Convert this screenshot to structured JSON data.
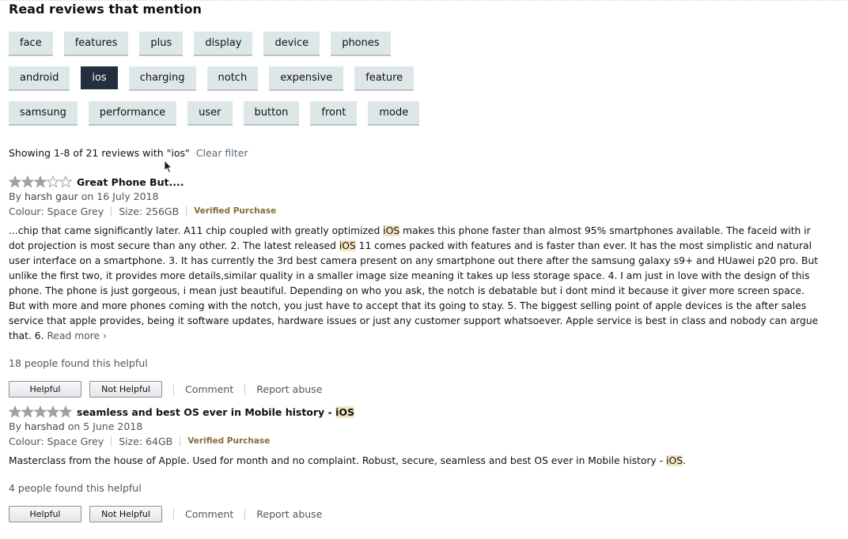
{
  "heading": "Read reviews that mention",
  "chips": {
    "row1": [
      "face",
      "features",
      "plus",
      "display",
      "device",
      "phones"
    ],
    "row2": [
      "android",
      "ios",
      "charging",
      "notch",
      "expensive",
      "feature"
    ],
    "row3": [
      "samsung",
      "performance",
      "user",
      "button",
      "front",
      "mode"
    ],
    "selected": "ios"
  },
  "filter": {
    "showing": "Showing 1-8 of 21 reviews with \"ios\"",
    "clear": "Clear filter"
  },
  "reviews": [
    {
      "rating": 3,
      "title": "Great Phone But....",
      "by": "By",
      "author": "harsh gaur",
      "date": "on 16 July 2018",
      "colour": "Colour: Space Grey",
      "size": "Size: 256GB",
      "verified": "Verified Purchase",
      "body_lines": [
        "...chip that came significantly later. A11 chip coupled with greatly optimized ",
        "iOS",
        " makes this phone faster than almost 95% smartphones available. The faceid with ir dot projection is most secure than any other. 2. The latest released ",
        "iOS",
        " 11 comes packed with features and is faster than ever. It has the most simplistic and natural user interface on a smartphone. 3. It has currently the 3rd best camera present on any smartphone out there after the samsung galaxy s9+ and HUawei p20 pro. But unlike the first two, it provides more details,similar quality in a smaller image size meaning it takes up less storage space. 4. I am just in love with the design of this phone. The phone is just gorgeous, i mean just beautiful. Depending on who you ask, the notch is debatable but i dont mind it because it giver more screen space. But with more and more phones coming with the notch, you just have to accept that its going to stay. 5. The biggest selling point of apple devices is the after sales service that apple provides, being it software updates, hardware issues or just any customer support whatsoever. Apple service is best in class and nobody can argue that. 6. "
      ],
      "read_more": "Read more ›",
      "helpful_count": "18 people found this helpful",
      "helpful_btn": "Helpful",
      "not_helpful_btn": "Not Helpful",
      "comment": "Comment",
      "report": "Report abuse"
    },
    {
      "rating": 5,
      "title_parts": [
        "seamless and best OS ever in Mobile history - ",
        "iOS"
      ],
      "by": "By",
      "author": "harshad",
      "date": "on 5 June 2018",
      "colour": "Colour: Space Grey",
      "size": "Size: 64GB",
      "verified": "Verified Purchase",
      "body_parts": [
        "Masterclass from the house of Apple. Used for month and no complaint. Robust, secure, seamless and best OS ever in Mobile history - ",
        "iOS",
        "."
      ],
      "helpful_count": "4 people found this helpful",
      "helpful_btn": "Helpful",
      "not_helpful_btn": "Not Helpful",
      "comment": "Comment",
      "report": "Report abuse"
    }
  ],
  "colors": {
    "chip_bg": "#dde7e8",
    "chip_selected_bg": "#232f3e",
    "star_fill": "#a2a2a2",
    "highlight": "#f3e6c2",
    "verified": "#8a6a3b"
  }
}
